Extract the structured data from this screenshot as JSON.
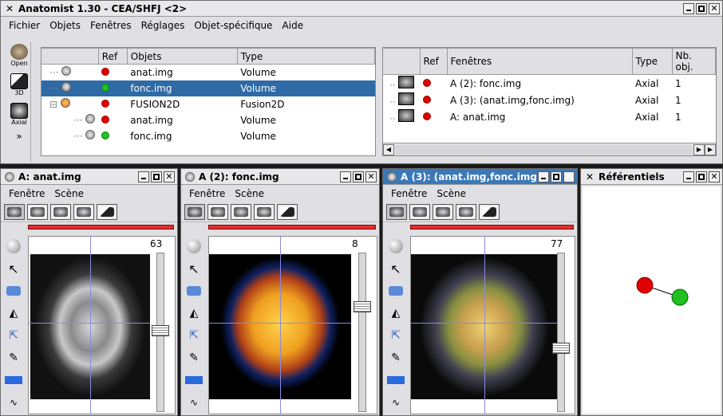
{
  "main": {
    "title": "Anatomist 1.30 - CEA/SHFJ <2>",
    "menu": [
      "Fichier",
      "Objets",
      "Fenêtres",
      "Réglages",
      "Objet-spécifique",
      "Aide"
    ],
    "tools": [
      {
        "label": "Open",
        "icon": "open-icon"
      },
      {
        "label": "3D",
        "icon": "3d-view-icon"
      },
      {
        "label": "Axial",
        "icon": "axial-view-icon"
      },
      {
        "label": "»",
        "icon": "more-chevron-icon"
      }
    ],
    "objects_table": {
      "headers": [
        "Ref",
        "Objets",
        "Type"
      ],
      "rows": [
        {
          "name": "anat.img",
          "type": "Volume",
          "ref": "red",
          "indent": 0,
          "selected": false
        },
        {
          "name": "fonc.img",
          "type": "Volume",
          "ref": "green",
          "indent": 0,
          "selected": true
        },
        {
          "name": "FUSION2D",
          "type": "Fusion2D",
          "ref": "red",
          "indent": 0,
          "selected": false
        },
        {
          "name": "anat.img",
          "type": "Volume",
          "ref": "red",
          "indent": 1,
          "selected": false
        },
        {
          "name": "fonc.img",
          "type": "Volume",
          "ref": "green",
          "indent": 1,
          "selected": false
        }
      ]
    },
    "windows_table": {
      "headers": [
        "Ref",
        "Fenêtres",
        "Type",
        "Nb. obj."
      ],
      "rows": [
        {
          "name": "A (2): fonc.img",
          "type": "Axial",
          "count": "1",
          "ref": "red"
        },
        {
          "name": "A (3): (anat.img,fonc.img)",
          "type": "Axial",
          "count": "1",
          "ref": "red"
        },
        {
          "name": "A: anat.img",
          "type": "Axial",
          "count": "1",
          "ref": "red"
        }
      ]
    }
  },
  "views": [
    {
      "title": "A: anat.img",
      "menu": [
        "Fenêtre",
        "Scène"
      ],
      "slice": "63",
      "image": "anat",
      "active": false
    },
    {
      "title": "A (2): fonc.img",
      "menu": [
        "Fenêtre",
        "Scène"
      ],
      "slice": "8",
      "image": "fonc",
      "active": false
    },
    {
      "title": "A (3): (anat.img,fonc.img)",
      "menu": [
        "Fenêtre",
        "Scène"
      ],
      "slice": "77",
      "image": "fusion",
      "active": true
    }
  ],
  "referentials": {
    "title": "Référentiels",
    "colors": [
      "#e00000",
      "#20c020"
    ]
  },
  "colors": {
    "selection": "#2e6aa6",
    "active_title": "#3b78b8",
    "crosshair": "#8a8adf"
  }
}
